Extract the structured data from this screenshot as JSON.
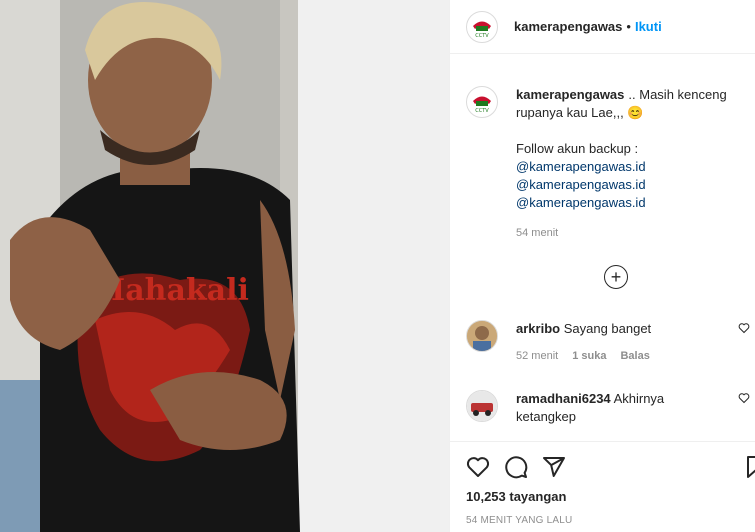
{
  "post": {
    "username": "kamerapengawas",
    "dot": "•",
    "follow_label": "Ikuti"
  },
  "caption": {
    "username": "kamerapengawas",
    "text_line1": ".. Masih kenceng",
    "text_line2": "rupanya kau Lae,,,",
    "emoji": "😊",
    "follow_text": "Follow akun backup :",
    "mentions": [
      "@kamerapengawas.id",
      "@kamerapengawas.id",
      "@kamerapengawas.id"
    ],
    "time": "54 menit"
  },
  "load_more_icon": "plus-circle-icon",
  "comments": [
    {
      "username": "arkribo",
      "text": "Sayang banget",
      "time": "52 menit",
      "likes": "1 suka",
      "reply": "Balas"
    },
    {
      "username": "ramadhani6234",
      "text_line1": "Akhirnya",
      "text_line2": "ketangkep"
    }
  ],
  "footer": {
    "views": "10,253 tayangan",
    "ago": "54 MENIT YANG LALU"
  },
  "colors": {
    "accent": "#0095f6",
    "mention": "#00376b",
    "muted": "#8e8e8e",
    "logo_red": "#c8102e"
  }
}
